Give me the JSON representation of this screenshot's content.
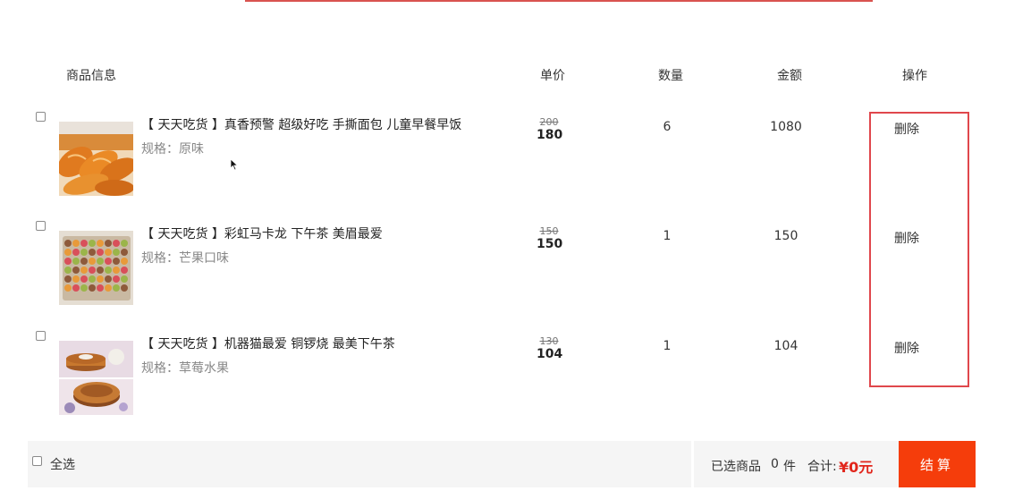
{
  "table": {
    "headers": {
      "product_info": "商品信息",
      "unit_price": "单价",
      "quantity": "数量",
      "amount": "金额",
      "action": "操作"
    }
  },
  "items": [
    {
      "title": "【 天天吃货 】真香预警 超级好吃 手撕面包 儿童早餐早饭",
      "spec": "规格：原味",
      "original_price": "200",
      "price": "180",
      "quantity": "6",
      "amount": "1080",
      "delete_label": "删除",
      "thumbnail": "hand-torn-bread-image",
      "checked": false
    },
    {
      "title": "【 天天吃货 】彩虹马卡龙 下午茶 美眉最爱",
      "spec": "规格：芒果口味",
      "original_price": "150",
      "price": "150",
      "quantity": "1",
      "amount": "150",
      "delete_label": "删除",
      "thumbnail": "macaron-tray-image",
      "checked": false
    },
    {
      "title": "【 天天吃货 】机器猫最爱 铜锣烧 最美下午茶",
      "spec": "规格：草莓水果",
      "original_price": "130",
      "price": "104",
      "quantity": "1",
      "amount": "104",
      "delete_label": "删除",
      "thumbnail": "dorayaki-image",
      "checked": false
    }
  ],
  "footer": {
    "select_all_label": "全选",
    "selected_label": "已选商品",
    "selected_count": "0",
    "selected_unit": "件",
    "total_label": "合计:",
    "total_value": "¥0元",
    "checkout_label": "结算"
  },
  "colors": {
    "accent": "#f53d0b",
    "price_red": "#e1251b",
    "highlight_border": "#e0474c",
    "footer_bg": "#f5f5f5"
  }
}
